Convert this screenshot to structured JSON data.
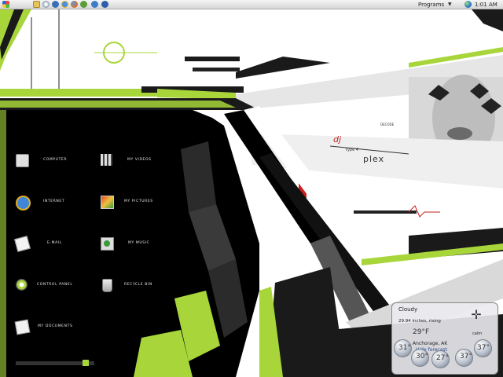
{
  "taskbar": {
    "icons": [
      "windows-logo-icon",
      "folder-icon",
      "disc-icon",
      "media-player-icon",
      "internet-explorer-icon",
      "firefox-icon",
      "messenger-icon",
      "network-icon",
      "chevron-icon"
    ],
    "programs_label": "Programs",
    "programs_arrow": "▼",
    "clock": "1:01 AM"
  },
  "wallpaper": {
    "dj_text": "dj",
    "type_text": "type 4",
    "plex_text": "plex",
    "decode_text": "DECODE"
  },
  "menu": {
    "items": [
      {
        "label": "COMPUTER",
        "icon": "computer-icon"
      },
      {
        "label": "MY VIDEOS",
        "icon": "film-icon"
      },
      {
        "label": "INTERNET",
        "icon": "internet-explorer-icon"
      },
      {
        "label": "MY PICTURES",
        "icon": "pictures-icon"
      },
      {
        "label": "E-MAIL",
        "icon": "mail-icon"
      },
      {
        "label": "MY MUSIC",
        "icon": "music-icon"
      },
      {
        "label": "CONTROL PANEL",
        "icon": "control-panel-icon"
      },
      {
        "label": "RECYCLE BIN",
        "icon": "recycle-bin-icon"
      },
      {
        "label": "MY DOCUMENTS",
        "icon": "documents-icon"
      }
    ]
  },
  "weather": {
    "condition": "Cloudy",
    "pressure": "29.94 inches, rising",
    "current_temp": "29°F",
    "location": "Anchorage, AK",
    "forecast_label": "Hide forecast",
    "corner_label": "calm",
    "forecast_temps": [
      "31°",
      "30°",
      "27°",
      "37°",
      "37°"
    ]
  },
  "colors": {
    "accent": "#a8d63a",
    "dark": "#000000",
    "red": "#cc1e1e"
  }
}
